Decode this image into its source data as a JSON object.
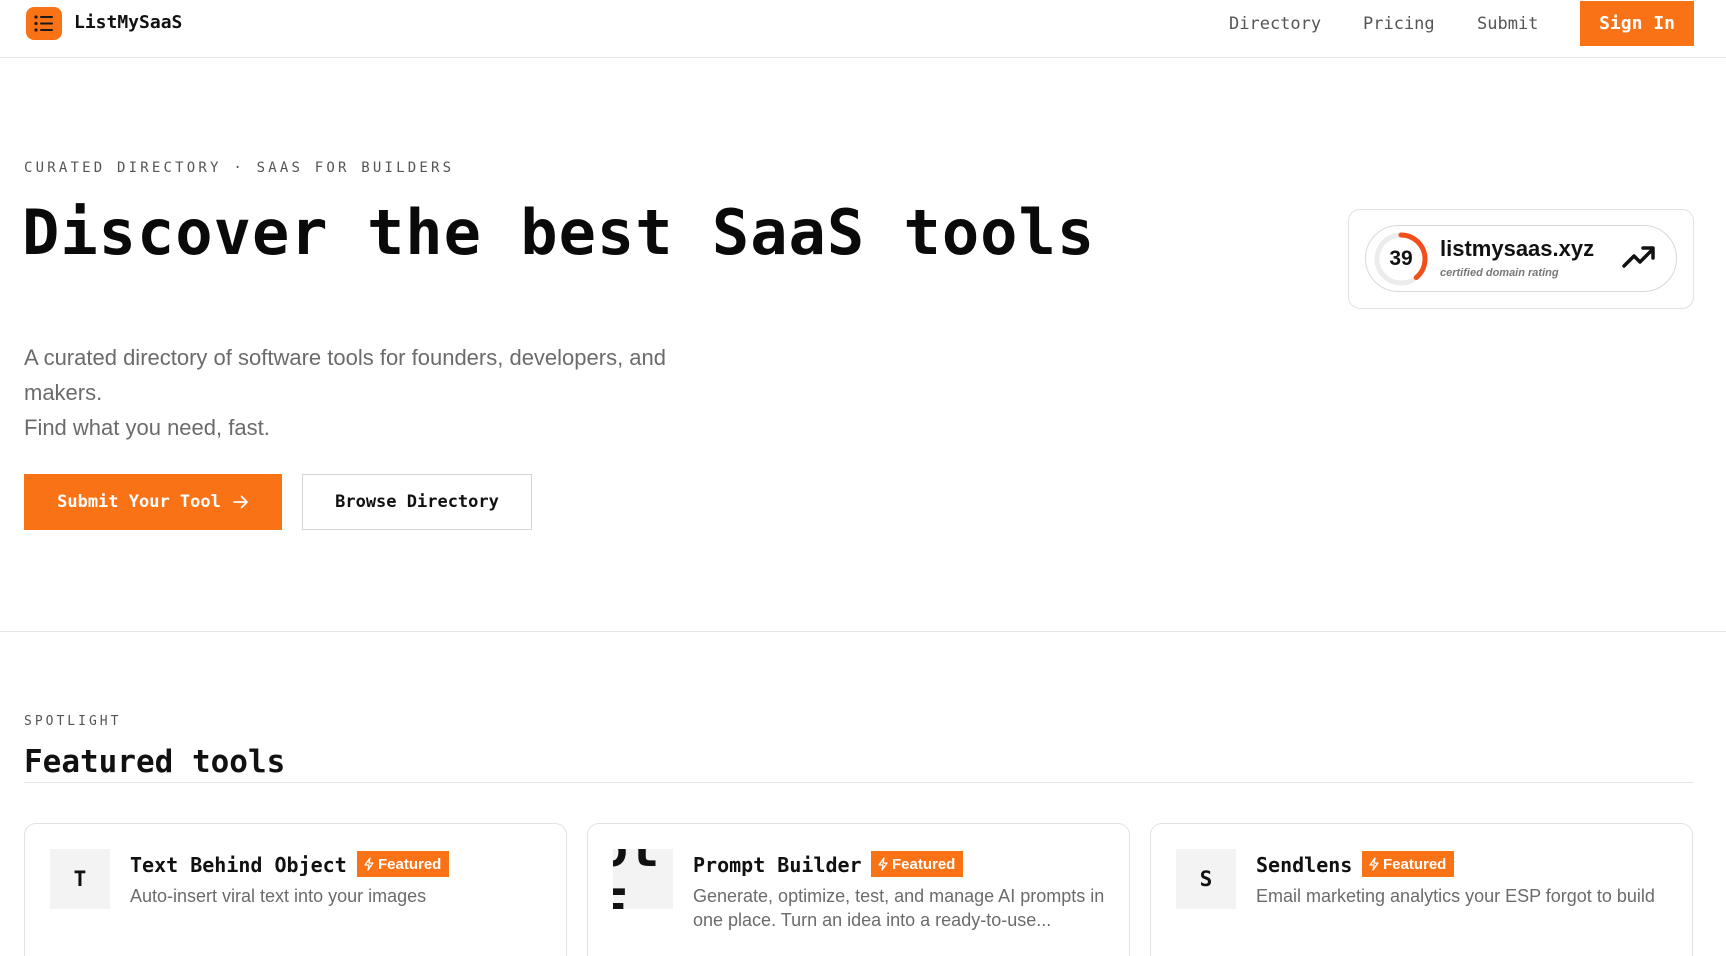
{
  "header": {
    "brand": "ListMySaaS",
    "nav": [
      "Directory",
      "Pricing",
      "Submit"
    ],
    "signin_label": "Sign In",
    "logo_icon": "list-icon",
    "accent": "#f97316"
  },
  "hero": {
    "eyebrow": "CURATED DIRECTORY · SAAS FOR BUILDERS",
    "title": "Discover the best SaaS tools",
    "desc_line1": "A curated directory of software tools for founders, developers, and makers.",
    "desc_line2": "Find what you need, fast.",
    "primary_cta": "Submit Your Tool",
    "secondary_cta": "Browse Directory"
  },
  "rating": {
    "score": "39",
    "score_fraction": 0.39,
    "domain": "listmysaas.xyz",
    "subtitle": "certified domain rating"
  },
  "spotlight": {
    "eyebrow": "SPOTLIGHT",
    "title": "Featured tools",
    "badge_label": "Featured",
    "cards": [
      {
        "logo": "T",
        "name": "Text Behind Object",
        "desc": "Auto-insert viral text into your images"
      },
      {
        "logo": "ot E",
        "name": "Prompt Builder",
        "desc": "Generate, optimize, test, and manage AI prompts in one place. Turn an idea into a ready-to-use..."
      },
      {
        "logo": "S",
        "name": "Sendlens",
        "desc": "Email marketing analytics your ESP forgot to build"
      }
    ]
  }
}
